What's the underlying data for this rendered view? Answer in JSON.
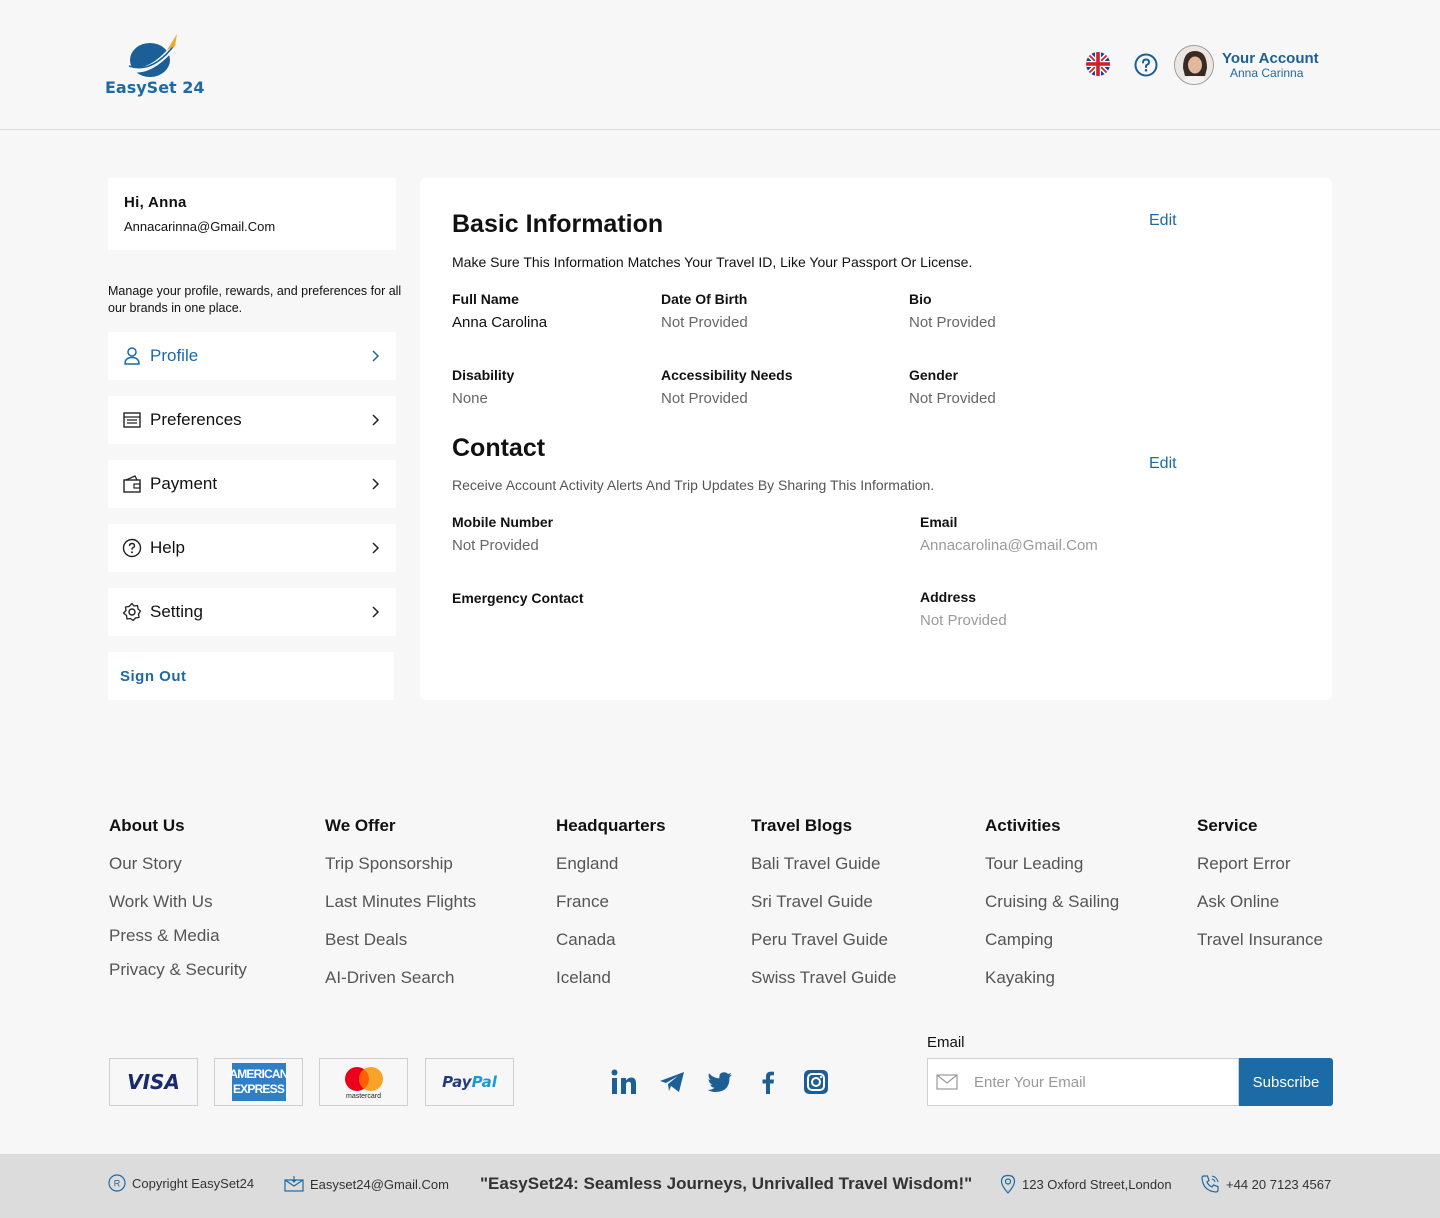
{
  "header": {
    "brand": "EasySet 24",
    "account_title": "Your Account",
    "account_name": "Anna Carinna"
  },
  "sidebar": {
    "greeting": "Hi, Anna",
    "email": "Annacarinna@Gmail.Com",
    "manage_text": "Manage your profile, rewards, and preferences for all our brands in one place.",
    "items": [
      {
        "label": "Profile",
        "icon": "user-icon"
      },
      {
        "label": "Preferences",
        "icon": "list-icon"
      },
      {
        "label": "Payment",
        "icon": "wallet-icon"
      },
      {
        "label": "Help",
        "icon": "help-icon"
      },
      {
        "label": "Setting",
        "icon": "gear-icon"
      }
    ],
    "sign_out": "Sign Out"
  },
  "basic": {
    "title": "Basic Information",
    "edit": "Edit",
    "description": "Make Sure This Information Matches Your Travel ID, Like Your Passport Or License.",
    "fields": [
      {
        "label": "Full Name",
        "value": "Anna Carolina"
      },
      {
        "label": "Date Of Birth",
        "value": "Not Provided"
      },
      {
        "label": "Bio",
        "value": "Not Provided"
      },
      {
        "label": "Disability",
        "value": "None"
      },
      {
        "label": "Accessibility Needs",
        "value": "Not Provided"
      },
      {
        "label": "Gender",
        "value": "Not Provided"
      }
    ]
  },
  "contact": {
    "title": "Contact",
    "edit": "Edit",
    "description": "Receive Account Activity Alerts And Trip Updates By Sharing This Information.",
    "fields": [
      {
        "label": "Mobile Number",
        "value": "Not Provided"
      },
      {
        "label": "Email",
        "value": "Annacarolina@Gmail.Com"
      },
      {
        "label": "Emergency Contact",
        "value": ""
      },
      {
        "label": "Address",
        "value": "Not Provided"
      }
    ]
  },
  "footer": {
    "columns": [
      {
        "heading": "About Us",
        "links": [
          "Our Story",
          "Work With Us",
          "Press & Media",
          "Privacy & Security"
        ]
      },
      {
        "heading": "We Offer",
        "links": [
          "Trip Sponsorship",
          "Last Minutes Flights",
          "Best Deals",
          "AI-Driven Search"
        ]
      },
      {
        "heading": "Headquarters",
        "links": [
          "England",
          "France",
          "Canada",
          "Iceland"
        ]
      },
      {
        "heading": "Travel Blogs",
        "links": [
          "Bali Travel Guide",
          "Sri Travel Guide",
          "Peru Travel Guide",
          "Swiss Travel Guide"
        ]
      },
      {
        "heading": "Activities",
        "links": [
          "Tour Leading",
          "Cruising & Sailing",
          "Camping",
          "Kayaking"
        ]
      },
      {
        "heading": "Service",
        "links": [
          "Report Error",
          "Ask Online",
          "Travel Insurance"
        ]
      }
    ],
    "payments": {
      "visa": "VISA",
      "amex_1": "AMERICAN",
      "amex_2": "EXPRESS",
      "mastercard": "mastercard",
      "paypal_1": "Pay",
      "paypal_2": "Pal"
    },
    "email_label": "Email",
    "email_placeholder": "Enter Your Email",
    "subscribe": "Subscribe",
    "copyright": "Copyright EasySet24",
    "contact_email": "Easyset24@Gmail.Com",
    "tagline": "\"EasySet24: Seamless Journeys, Unrivalled Travel Wisdom!\"",
    "address": "123 Oxford Street,London",
    "phone": "+44 20 7123 4567"
  },
  "colors": {
    "accent": "#1c6aa6",
    "background": "#f7f7f7",
    "bottom_bar": "#dcdcdc"
  }
}
